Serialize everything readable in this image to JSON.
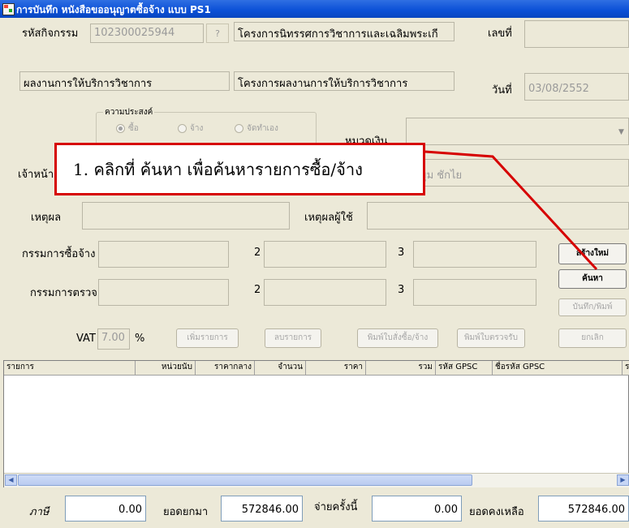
{
  "window": {
    "title": "การบันทึก หนังสือขออนุญาตซื้อจ้าง แบบ PS1"
  },
  "header": {
    "activity_label": "รหัสกิจกรรม",
    "activity_code": "102300025944",
    "lookup_button": "?",
    "project_name": "โครงการนิทรรศการวิชาการและเฉลิมพระเกี",
    "number_label": "เลขที่",
    "number_value": "",
    "output_name": "ผลงานการให้บริการวิชาการ",
    "project_output": "โครงการผลงานการให้บริการวิชาการ",
    "date_label": "วันที่",
    "date_value": "03/08/2552"
  },
  "purpose": {
    "title": "ความประสงค์",
    "options": [
      "ซื้อ",
      "จ้าง",
      "จัดทำเอง"
    ],
    "selected": "ซื้อ"
  },
  "budget": {
    "label": "หมวดเงิน",
    "value": ""
  },
  "officer": {
    "label": "เจ้าหน้า",
    "value": "มุม ชักไย"
  },
  "reason": {
    "label": "เหตุผล",
    "user_reason_label": "เหตุผลผู้ใช้"
  },
  "committee": {
    "purchase_label": "กรรมการซื้อจ้าง",
    "inspect_label": "กรรมการตรวจ",
    "col2": "2",
    "col3": "3"
  },
  "vat": {
    "label": "VAT",
    "value": "7.00",
    "unit": "%"
  },
  "actions": {
    "add_item": "เพิ่มรายการ",
    "delete_item": "ลบรายการ",
    "print_po": "พิมพ์ใบสั่งซื้อ/จ้าง",
    "print_receipt": "พิมพ์ใบตรวจรับ",
    "cancel": "ยกเลิก",
    "create_new": "สร้างใหม่",
    "search": "ค้นหา",
    "save_print": "บันทึก/พิมพ์"
  },
  "grid": {
    "columns": [
      "รายการ",
      "หน่วยนับ",
      "ราคากลาง",
      "จำนวน",
      "ราคา",
      "รวม",
      "รหัส GPSC",
      "ชื่อรหัส GPSC",
      "ร"
    ],
    "rows": []
  },
  "footer": {
    "tax_label": "ภาษี",
    "tax_value": "0.00",
    "carried_label": "ยอดยกมา",
    "carried_value": "572846.00",
    "paid_label": "จ่ายครั้งนี้",
    "paid_value": "0.00",
    "remaining_label": "ยอดคงเหลือ",
    "remaining_value": "572846.00"
  },
  "annotation": {
    "text": "1. คลิกที่ ค้นหา เพื่อค้นหารายการซื้อ/จ้าง",
    "color": "#d60000"
  }
}
